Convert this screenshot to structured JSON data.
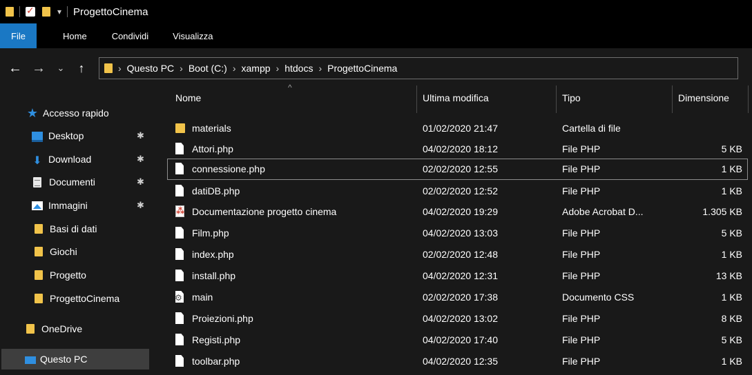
{
  "window": {
    "title": "ProgettoCinema"
  },
  "ribbon": {
    "file": "File",
    "home": "Home",
    "share": "Condividi",
    "view": "Visualizza"
  },
  "address": {
    "crumbs": [
      "Questo PC",
      "Boot (C:)",
      "xampp",
      "htdocs",
      "ProgettoCinema"
    ]
  },
  "sidebar": {
    "items": [
      {
        "label": "Accesso rapido",
        "icon": "star-icon"
      },
      {
        "label": "Desktop",
        "icon": "desktop-icon",
        "pinned": true
      },
      {
        "label": "Download",
        "icon": "download-icon",
        "pinned": true
      },
      {
        "label": "Documenti",
        "icon": "documents-icon",
        "pinned": true
      },
      {
        "label": "Immagini",
        "icon": "pictures-icon",
        "pinned": true
      },
      {
        "label": "Basi di dati",
        "icon": "folder-icon"
      },
      {
        "label": "Giochi",
        "icon": "folder-icon"
      },
      {
        "label": "Progetto",
        "icon": "folder-icon"
      },
      {
        "label": "ProgettoCinema",
        "icon": "folder-icon"
      },
      {
        "label": "OneDrive",
        "icon": "folder-icon"
      },
      {
        "label": "Questo PC",
        "icon": "pc-icon",
        "active": true
      }
    ]
  },
  "columns": {
    "name": "Nome",
    "modified": "Ultima modifica",
    "type": "Tipo",
    "size": "Dimensione"
  },
  "files": [
    {
      "name": "materials",
      "modified": "01/02/2020 21:47",
      "type": "Cartella di file",
      "size": "",
      "icon": "folder-icon"
    },
    {
      "name": "Attori.php",
      "modified": "04/02/2020 18:12",
      "type": "File PHP",
      "size": "5 KB",
      "icon": "file-icon"
    },
    {
      "name": "connessione.php",
      "modified": "02/02/2020 12:55",
      "type": "File PHP",
      "size": "1 KB",
      "icon": "file-icon",
      "selected": true
    },
    {
      "name": "datiDB.php",
      "modified": "02/02/2020 12:52",
      "type": "File PHP",
      "size": "1 KB",
      "icon": "file-icon"
    },
    {
      "name": "Documentazione progetto cinema",
      "modified": "04/02/2020 19:29",
      "type": "Adobe Acrobat D...",
      "size": "1.305 KB",
      "icon": "pdf-icon"
    },
    {
      "name": "Film.php",
      "modified": "04/02/2020 13:03",
      "type": "File PHP",
      "size": "5 KB",
      "icon": "file-icon"
    },
    {
      "name": "index.php",
      "modified": "02/02/2020 12:48",
      "type": "File PHP",
      "size": "1 KB",
      "icon": "file-icon"
    },
    {
      "name": "install.php",
      "modified": "04/02/2020 12:31",
      "type": "File PHP",
      "size": "13 KB",
      "icon": "file-icon"
    },
    {
      "name": "main",
      "modified": "02/02/2020 17:38",
      "type": "Documento CSS",
      "size": "1 KB",
      "icon": "css-icon"
    },
    {
      "name": "Proiezioni.php",
      "modified": "04/02/2020 13:02",
      "type": "File PHP",
      "size": "8 KB",
      "icon": "file-icon"
    },
    {
      "name": "Registi.php",
      "modified": "04/02/2020 17:40",
      "type": "File PHP",
      "size": "5 KB",
      "icon": "file-icon"
    },
    {
      "name": "toolbar.php",
      "modified": "04/02/2020 12:35",
      "type": "File PHP",
      "size": "1 KB",
      "icon": "file-icon"
    }
  ]
}
